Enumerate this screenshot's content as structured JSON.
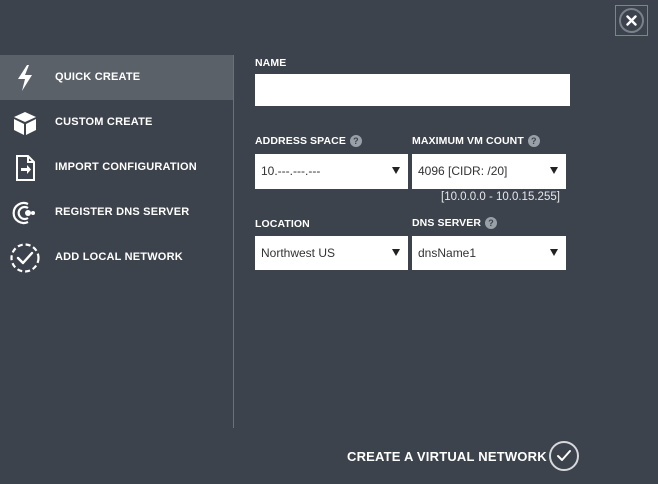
{
  "sidebar": {
    "items": [
      {
        "label": "QUICK CREATE",
        "icon": "lightning-icon",
        "active": true
      },
      {
        "label": "CUSTOM CREATE",
        "icon": "cube-icon",
        "active": false
      },
      {
        "label": "IMPORT CONFIGURATION",
        "icon": "import-file-icon",
        "active": false
      },
      {
        "label": "REGISTER DNS SERVER",
        "icon": "dns-server-icon",
        "active": false
      },
      {
        "label": "ADD LOCAL NETWORK",
        "icon": "local-network-icon",
        "active": false
      }
    ]
  },
  "form": {
    "name": {
      "label": "NAME",
      "value": ""
    },
    "address_space": {
      "label": "ADDRESS SPACE",
      "value": "10.---.---.---",
      "help": "?"
    },
    "max_vm_count": {
      "label": "MAXIMUM VM COUNT",
      "value": "4096 [CIDR: /20]",
      "help": "?"
    },
    "range_note": "[10.0.0.0 - 10.0.15.255]",
    "location": {
      "label": "LOCATION",
      "value": "Northwest US"
    },
    "dns_server": {
      "label": "DNS SERVER",
      "value": "dnsName1",
      "help": "?"
    }
  },
  "actions": {
    "create_label": "CREATE A VIRTUAL NETWORK",
    "close_icon": "close-icon",
    "confirm_icon": "checkmark-icon"
  },
  "colors": {
    "background": "#3d434c",
    "active_item": "#5b6169",
    "close_border": "#4d8fd6"
  }
}
